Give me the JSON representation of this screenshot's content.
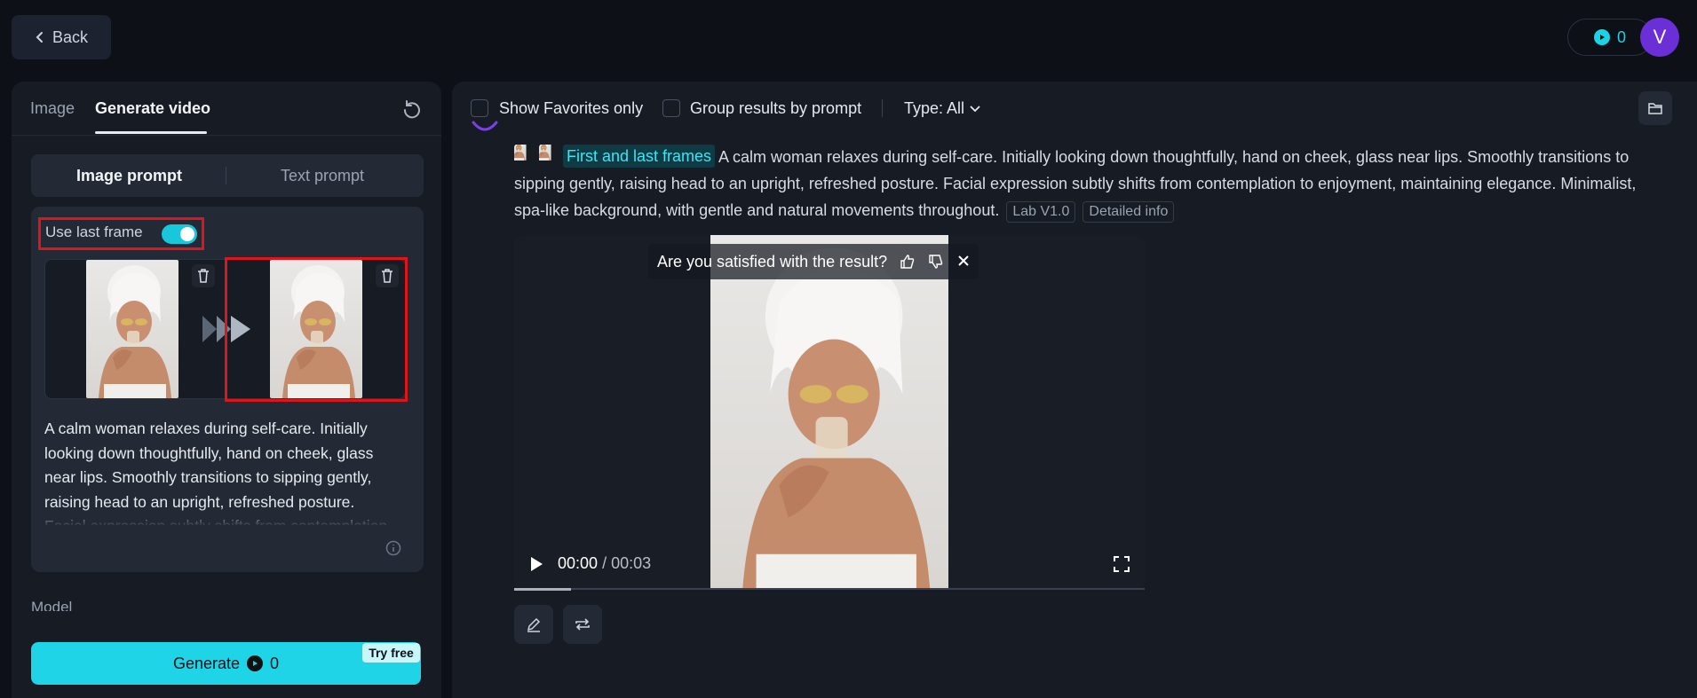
{
  "header": {
    "back_label": "Back",
    "credits": "0",
    "avatar_initial": "V"
  },
  "left_panel": {
    "tabs": [
      {
        "label": "Image",
        "active": false
      },
      {
        "label": "Generate video",
        "active": true
      }
    ],
    "prompt_modes": [
      {
        "label": "Image prompt",
        "active": true
      },
      {
        "label": "Text prompt",
        "active": false
      }
    ],
    "use_last_frame": {
      "label": "Use last frame",
      "enabled": true
    },
    "prompt_text": "A calm woman relaxes during self-care. Initially looking down thoughtfully, hand on cheek, glass near lips. Smoothly transitions to sipping gently, raising head to an upright, refreshed posture. Facial expression subtly shifts from contemplation to enjoyment, maintaining elegance. Minimalist, spa-like background, with gentle and natural movements throughout.",
    "model_label": "Model",
    "generate": {
      "label": "Generate",
      "cost": "0",
      "badge": "Try free"
    }
  },
  "results": {
    "filters": {
      "show_favorites_label": "Show Favorites only",
      "group_by_prompt_label": "Group results by prompt",
      "type_label": "Type: All"
    },
    "item": {
      "mode_chip": "First and last frames",
      "description": "A calm woman relaxes during self-care. Initially looking down thoughtfully, hand on cheek, glass near lips. Smoothly transitions to sipping gently, raising head to an upright, refreshed posture. Facial expression subtly shifts from contemplation to enjoyment, maintaining elegance. Minimalist, spa-like background, with gentle and natural movements throughout.",
      "tags": [
        "Lab V1.0",
        "Detailed info"
      ],
      "feedback_prompt": "Are you satisfied with the result?",
      "current_time": "00:00",
      "duration": "/ 00:03",
      "progress": 0.09
    }
  },
  "colors": {
    "accent": "#1ed4e6",
    "background": "#0d1016",
    "panel": "#161b24",
    "highlight_red": "#e0141b",
    "avatar": "#6a2fd6"
  }
}
